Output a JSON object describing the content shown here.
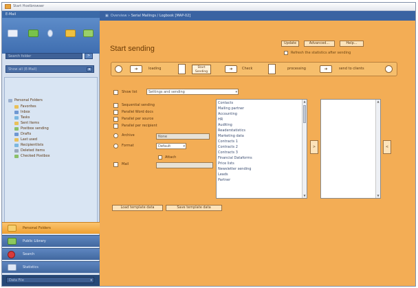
{
  "window": {
    "title": "Start Hostbrowser"
  },
  "left_panel": {
    "header": "E-Mail",
    "search": {
      "placeholder": "Search folder",
      "go_label": ">"
    },
    "view_combo": {
      "value": "Show all (E-Mail)"
    },
    "tree": {
      "root": "Personal Folders",
      "items": [
        "Favorites",
        "Inbox",
        "Tasks",
        "Sent Items",
        "Postbox sending",
        "Drafts",
        "Last used",
        "Recipientlists",
        "Deleted items",
        "Checked Postbox"
      ]
    },
    "nav": [
      {
        "label": "Personal Folders",
        "active": true,
        "icon": "folder-icon"
      },
      {
        "label": "Public Library",
        "active": false,
        "icon": "library-icon"
      },
      {
        "label": "Search",
        "active": false,
        "icon": "search-icon"
      },
      {
        "label": "Statistics",
        "active": false,
        "icon": "statistics-icon"
      }
    ],
    "status": {
      "value": "Data File"
    }
  },
  "tab": {
    "breadcrumb": "Overview",
    "title": "Serial Mailings / Logbook [MAP-02]"
  },
  "main": {
    "title": "Start sending",
    "buttons": {
      "update": "Update",
      "advanced": "Advanced...",
      "help": "Help..."
    },
    "refresh_label": "Refresh the statistics after sending",
    "steps": {
      "loading": "loading",
      "start_label": "Start Sending",
      "check": "Check",
      "processing": "processing",
      "send": "send to clients"
    },
    "filter": {
      "label": "Show list",
      "value": "Settings and sending"
    },
    "options": [
      "Sequential sending",
      "Parallel Word docs",
      "Parallel per source",
      "Parallel per recipient"
    ],
    "archive_label": "Archive",
    "archive_value": "None",
    "format_label": "Format",
    "format_value": "Default",
    "attach_label": "Attach",
    "mail_label": "Mail",
    "list_items": [
      "Contacts",
      "Mailing partner",
      "Accounting",
      "HR",
      "Auditing",
      "Readerstatistics",
      "Marketing data",
      "Contracts 1",
      "Contracts 2",
      "Contracts 3",
      "Financial Dataforms",
      "Price lists",
      "Newsletter sending",
      "Leads",
      "Partner"
    ],
    "add_label": ">",
    "remove_label": "<",
    "bottom_buttons": {
      "load": "Load template data",
      "save": "Save template data"
    }
  },
  "colors": {
    "accent": "#f3ad55",
    "nav_blue": "#3a63a2",
    "active_orange": "#f0a030"
  }
}
